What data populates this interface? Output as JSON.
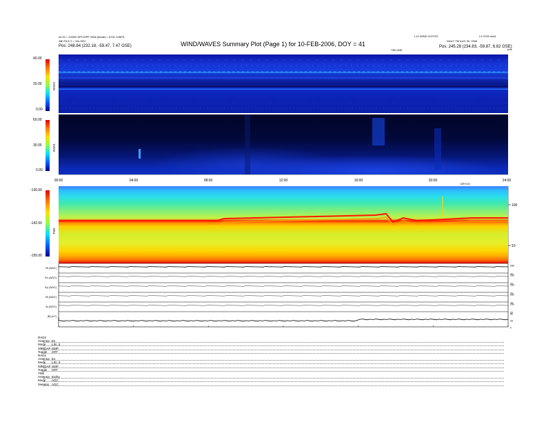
{
  "header": {
    "title": "WIND/WAVES Summary Plot (Page 1) for 10-FEB-2006, DOY = 41",
    "left_line1": "s0.20 = 2/2000 SPC/SFP 2006 (Mode) = 6731 SJ6PS",
    "left_line2": "ABI FILE 2 = 10s DEC",
    "left_pos": "Pos:  248.84 (232.18, -59.47, 7.47 GSE)",
    "right_line1": "1.10 WIND 2UT/GS",
    "right_line2": "LX 9700 mts1",
    "right_line3": "DAILY TM AUG 30, 2006",
    "right_pos": "Pos:  245.28 (234.83, -59.87, 6.82 GSE)",
    "time_label": "TIM UNK",
    "corner_label": "kHz"
  },
  "chart_data": [
    {
      "type": "heatmap",
      "name": "RAD2",
      "ylabel": "RAD2",
      "yticks": [
        "40.00",
        "20.00",
        "0.00"
      ],
      "ylim": [
        0,
        40
      ]
    },
    {
      "type": "heatmap",
      "name": "RAD1",
      "ylabel": "RAD1",
      "yticks": [
        "60.00",
        "30.00",
        "0.00"
      ],
      "ylim": [
        0,
        60
      ],
      "xticks": [
        "00:00",
        "04:00",
        "08:00",
        "12:00",
        "16:00",
        "20:00",
        "24:00"
      ],
      "x_range_label": "DRY:00"
    },
    {
      "type": "heatmap",
      "name": "TNR",
      "ylabel": "TNR",
      "yticks": [
        "-130.00",
        "-142.50",
        "-155.00"
      ],
      "ylim": [
        -155,
        -130
      ],
      "right_ticks": [
        "100",
        "10"
      ]
    },
    {
      "type": "line",
      "strips": [
        {
          "label": "Bl (ADC)",
          "right": [
            "250",
            "20"
          ]
        },
        {
          "label": "Ex (ADC)",
          "right": [
            "250",
            "20"
          ]
        },
        {
          "label": "Ey (ADC)",
          "right": [
            "250",
            "20"
          ]
        },
        {
          "label": "Bl (ADC)",
          "right": [
            "250",
            "20"
          ]
        },
        {
          "label": "Ai (ADC)",
          "right": [
            "250",
            "20"
          ]
        },
        {
          "label": "|B| (nT)",
          "right": [
            "50",
            "25",
            "0"
          ]
        }
      ],
      "xticks": [
        "0000",
        "0400",
        "0800",
        "1200",
        "1600",
        "2000",
        "2400"
      ]
    }
  ],
  "legend_block": [
    {
      "section": "RAD2"
    },
    {
      "key": "Antenna",
      "val": "Ex"
    },
    {
      "key": "Mode",
      "val": "LIN_S"
    },
    {
      "key": "3dB/DAP",
      "val": "SMP"
    },
    {
      "key": "Toggle",
      "val": "OFF"
    },
    {
      "section": "RAD1"
    },
    {
      "key": "Antenna",
      "val": "Ex"
    },
    {
      "key": "Mode",
      "val": "LIN_S"
    },
    {
      "key": "3dB/DAP",
      "val": "SMP"
    },
    {
      "key": "Toggle",
      "val": "OFF"
    },
    {
      "section": "TNR"
    },
    {
      "key": "Antenna",
      "val": "Ex/Ey"
    },
    {
      "key": "Mode",
      "val": "AGC"
    },
    {
      "key": "Sweeps",
      "val": "AGC"
    }
  ]
}
